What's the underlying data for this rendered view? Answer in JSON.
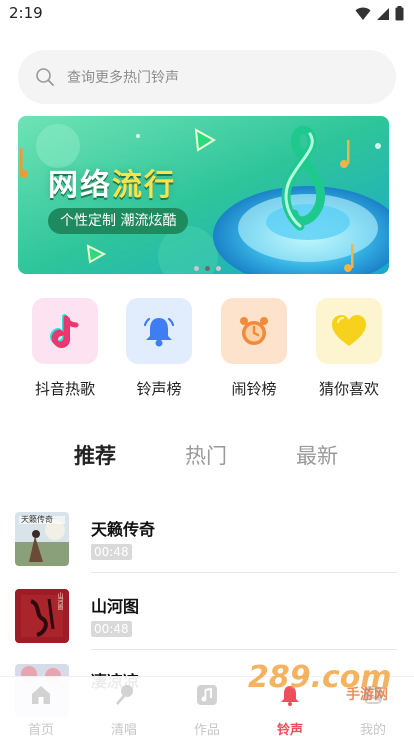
{
  "status_bar": {
    "time": "2:19"
  },
  "search": {
    "placeholder": "查询更多热门铃声"
  },
  "banner": {
    "title_part1": "网络",
    "title_part2": "流行",
    "subtitle": "个性定制 潮流炫酷",
    "slides": 3,
    "active_slide": 1
  },
  "quick_links": [
    {
      "label": "抖音热歌",
      "icon": "tiktok-note-icon"
    },
    {
      "label": "铃声榜",
      "icon": "bell-icon"
    },
    {
      "label": "闹铃榜",
      "icon": "alarm-clock-icon"
    },
    {
      "label": "猜你喜欢",
      "icon": "heart-icon"
    }
  ],
  "tabs": [
    {
      "label": "推荐",
      "active": true
    },
    {
      "label": "热门",
      "active": false
    },
    {
      "label": "最新",
      "active": false
    }
  ],
  "songs": [
    {
      "title": "天籁传奇",
      "duration": "00:48",
      "cover_text": "天籁传奇"
    },
    {
      "title": "山河图",
      "duration": "00:48",
      "cover_text": "山河图"
    },
    {
      "title": "凄凉凉",
      "duration": "",
      "cover_text": ""
    }
  ],
  "bottom_nav": [
    {
      "label": "首页",
      "icon": "home-icon",
      "active": false
    },
    {
      "label": "清唱",
      "icon": "microphone-icon",
      "active": false
    },
    {
      "label": "作品",
      "icon": "music-note-icon",
      "active": false
    },
    {
      "label": "铃声",
      "icon": "bell-icon",
      "active": true
    },
    {
      "label": "我的",
      "icon": "user-icon",
      "active": false
    }
  ],
  "watermark": {
    "text": "289.com",
    "subtext": "手游网"
  },
  "colors": {
    "accent": "#ee4d5b",
    "inactive": "#c7c7c7",
    "search_bg": "#f4f4f5"
  }
}
